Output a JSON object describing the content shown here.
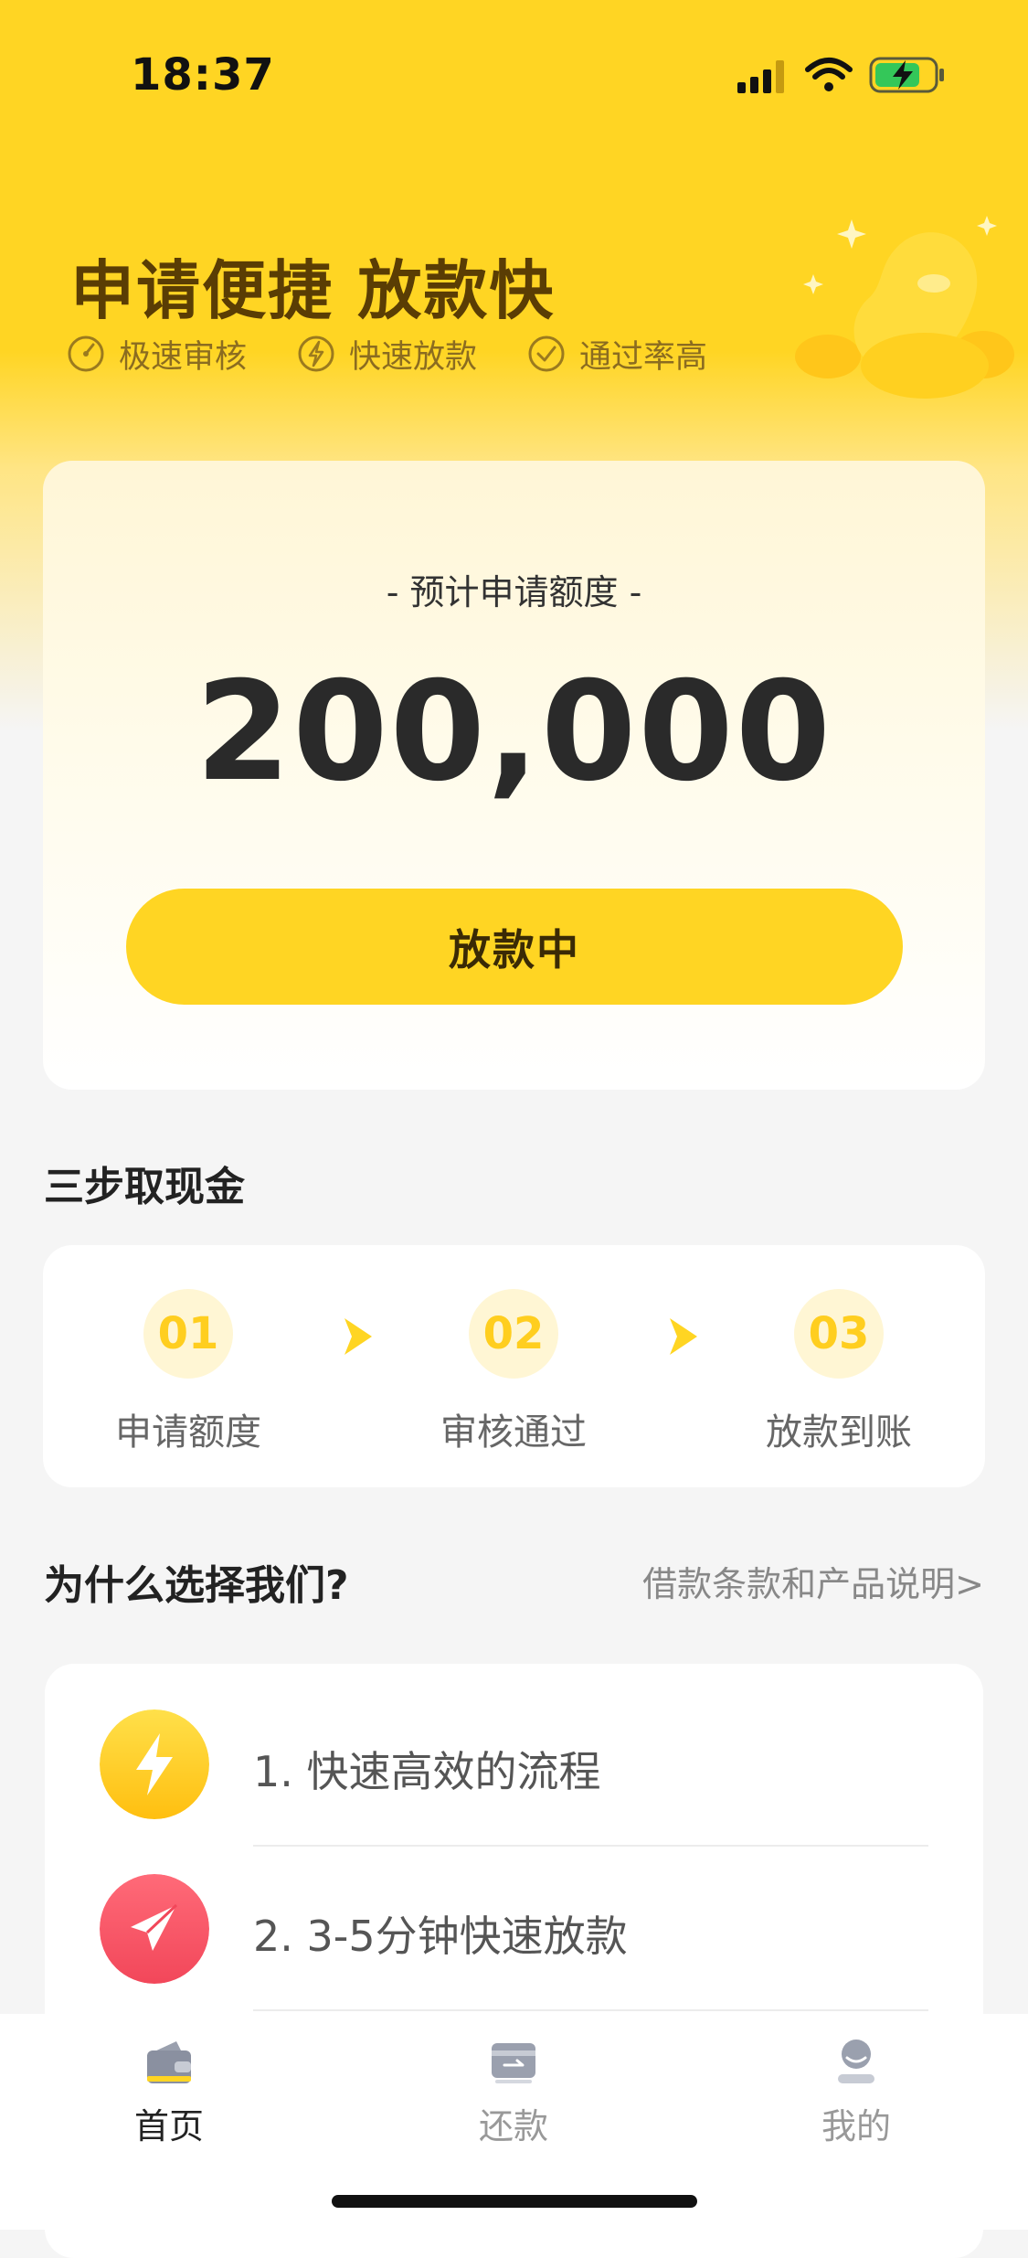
{
  "status_bar": {
    "time": "18:37"
  },
  "hero": {
    "title": "申请便捷 放款快",
    "features": [
      {
        "icon": "speedometer-icon",
        "label": "极速审核"
      },
      {
        "icon": "lightning-icon",
        "label": "快速放款"
      },
      {
        "icon": "check-circle-icon",
        "label": "通过率高"
      }
    ]
  },
  "quota": {
    "label": "- 预计申请额度 -",
    "amount": "200,000",
    "button_label": "放款中"
  },
  "steps": {
    "title": "三步取现金",
    "items": [
      {
        "number": "01",
        "label": "申请额度"
      },
      {
        "number": "02",
        "label": "审核通过"
      },
      {
        "number": "03",
        "label": "放款到账"
      }
    ]
  },
  "why": {
    "title": "为什么选择我们?",
    "terms_link": "借款条款和产品说明>",
    "items": [
      {
        "icon": "lightning-icon",
        "text": "1. 快速高效的流程"
      },
      {
        "icon": "rocket-icon",
        "text": "2. 3-5分钟快速放款"
      }
    ]
  },
  "tab_bar": {
    "tabs": [
      {
        "icon": "wallet-icon",
        "label": "首页",
        "active": true
      },
      {
        "icon": "card-icon",
        "label": "还款",
        "active": false
      },
      {
        "icon": "user-icon",
        "label": "我的",
        "active": false
      }
    ]
  },
  "colors": {
    "brand": "#ffd523",
    "step_number": "#ffce1f",
    "rocket": "#f5515f"
  }
}
